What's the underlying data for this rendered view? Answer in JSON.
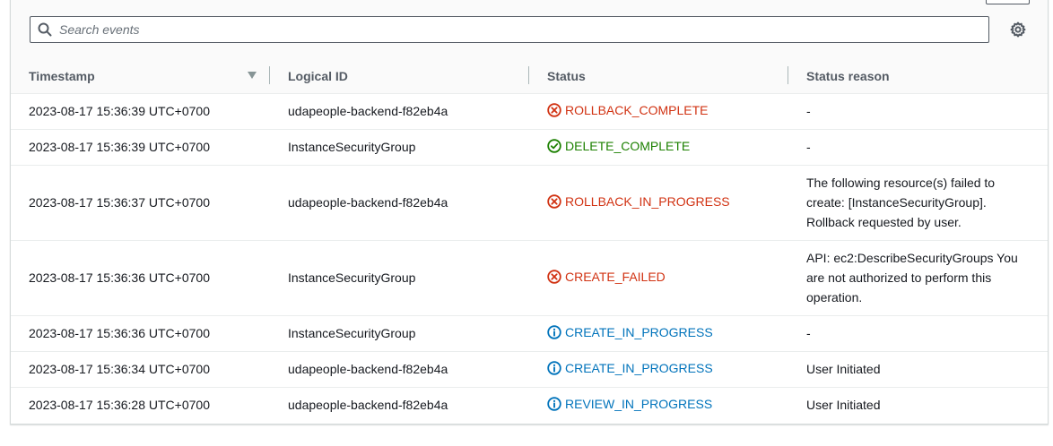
{
  "search": {
    "placeholder": "Search events"
  },
  "columns": {
    "timestamp": "Timestamp",
    "logical_id": "Logical ID",
    "status": "Status",
    "status_reason": "Status reason"
  },
  "colors": {
    "error": "#d13212",
    "success": "#1d8102",
    "info": "#0073bb"
  },
  "events": [
    {
      "timestamp": "2023-08-17 15:36:39 UTC+0700",
      "logical_id": "udapeople-backend-f82eb4a",
      "status": "ROLLBACK_COMPLETE",
      "status_type": "error",
      "icon": "error-icon",
      "reason": "-"
    },
    {
      "timestamp": "2023-08-17 15:36:39 UTC+0700",
      "logical_id": "InstanceSecurityGroup",
      "status": "DELETE_COMPLETE",
      "status_type": "success",
      "icon": "success-icon",
      "reason": "-"
    },
    {
      "timestamp": "2023-08-17 15:36:37 UTC+0700",
      "logical_id": "udapeople-backend-f82eb4a",
      "status": "ROLLBACK_IN_PROGRESS",
      "status_type": "error",
      "icon": "error-icon",
      "reason": "The following resource(s) failed to create: [InstanceSecurityGroup]. Rollback requested by user."
    },
    {
      "timestamp": "2023-08-17 15:36:36 UTC+0700",
      "logical_id": "InstanceSecurityGroup",
      "status": "CREATE_FAILED",
      "status_type": "error",
      "icon": "error-icon",
      "reason": "API: ec2:DescribeSecurityGroups You are not authorized to perform this operation."
    },
    {
      "timestamp": "2023-08-17 15:36:36 UTC+0700",
      "logical_id": "InstanceSecurityGroup",
      "status": "CREATE_IN_PROGRESS",
      "status_type": "info",
      "icon": "info-icon",
      "reason": "-"
    },
    {
      "timestamp": "2023-08-17 15:36:34 UTC+0700",
      "logical_id": "udapeople-backend-f82eb4a",
      "status": "CREATE_IN_PROGRESS",
      "status_type": "info",
      "icon": "info-icon",
      "reason": "User Initiated"
    },
    {
      "timestamp": "2023-08-17 15:36:28 UTC+0700",
      "logical_id": "udapeople-backend-f82eb4a",
      "status": "REVIEW_IN_PROGRESS",
      "status_type": "info",
      "icon": "info-icon",
      "reason": "User Initiated"
    }
  ]
}
